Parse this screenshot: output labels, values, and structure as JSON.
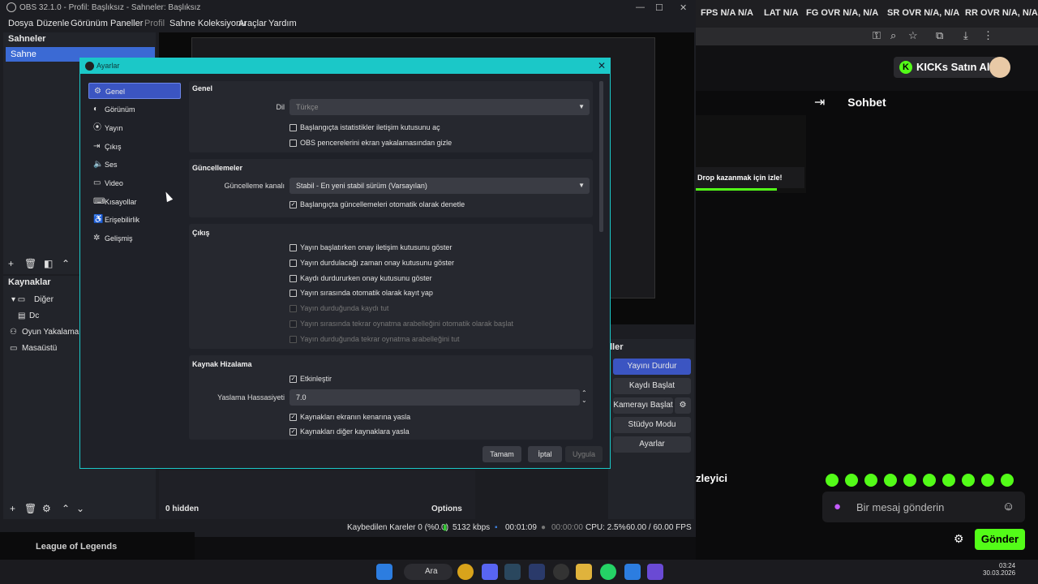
{
  "browser": {
    "tabs": [
      "FPS N/A N/A",
      "LAT N/A",
      "FG OVR N/A, N/A",
      "SR OVR N/A, N/A",
      "RR OVR N/A, N/A"
    ],
    "buy_button": "KICKs Satın Al",
    "chat_title": "Sohbet",
    "drop_banner": "Drop kazanmak için izle!",
    "viewer_label": "zleyici",
    "chat_placeholder": "Bir mesaj gönderin",
    "send_label": "Gönder"
  },
  "obs": {
    "title": "OBS 32.1.0 - Profil: Başlıksız - Sahneler: Başlıksız",
    "menu": [
      "Dosya",
      "Düzenle",
      "Görünüm",
      "Paneller",
      "Profil",
      "Sahne Koleksiyonu",
      "Araçlar",
      "Yardım"
    ],
    "scenes_title": "Sahneler",
    "scene_name": "Sahne",
    "sources_title": "Kaynaklar",
    "sources": [
      "Diğer",
      "Dc",
      "Oyun Yakalama",
      "Masaüstü"
    ],
    "hidden_label": "0 hidden",
    "options_label": "Options",
    "controls": {
      "title": "ller",
      "buttons": [
        "Yayını Durdur",
        "Kaydı Başlat",
        "Kamerayı Başlat",
        "Stüdyo Modu",
        "Ayarlar"
      ]
    },
    "status": {
      "dropped": "Kaybedilen Kareler 0 (%0.0)",
      "bitrate": "5132 kbps",
      "stream_time": "00:01:09",
      "rec_time": "00:00:00",
      "cpu": "CPU: 2.5%",
      "fps": "60.00 / 60.00 FPS"
    }
  },
  "game": {
    "name": "League of Legends"
  },
  "taskbar": {
    "search_label": "Ara",
    "time": "03:24",
    "date": "30.03.2026"
  },
  "settings": {
    "title": "Ayarlar",
    "nav": [
      "Genel",
      "Görünüm",
      "Yayın",
      "Çıkış",
      "Ses",
      "Video",
      "Kısayollar",
      "Erişebilirlik",
      "Gelişmiş"
    ],
    "nav_icons": [
      "⚙",
      "◐",
      "⦿",
      "⇥",
      "🔈",
      "▭",
      "⌨",
      "♿",
      "✲"
    ],
    "general": {
      "title": "Genel",
      "language_label": "Dil",
      "language_value": "Türkçe",
      "checks": [
        "Başlangıçta istatistikler iletişim kutusunu aç",
        "OBS pencerelerini ekran yakalamasından gizle"
      ]
    },
    "updates": {
      "title": "Güncellemeler",
      "channel_label": "Güncelleme kanalı",
      "channel_value": "Stabil - En yeni stabil sürüm (Varsayılan)",
      "check": "Başlangıçta güncellemeleri otomatik olarak denetle"
    },
    "output": {
      "title": "Çıkış",
      "checks": [
        "Yayın başlatırken onay iletişim kutusunu göster",
        "Yayın durdulacağı zaman onay kutusunu göster",
        "Kaydı durdururken onay kutusunu göster",
        "Yayın sırasında otomatik olarak kayıt yap",
        "Yayın durduğunda kaydı tut",
        "Yayın sırasında tekrar oynatma arabelleğini otomatik olarak başlat",
        "Yayın durduğunda tekrar oynatma arabelleğini tut"
      ]
    },
    "snap": {
      "title": "Kaynak Hizalama",
      "enable": "Etkinleştir",
      "sensitivity_label": "Yaslama Hassasiyeti",
      "sensitivity_value": "7.0",
      "checks": [
        "Kaynakları ekranın kenarına yasla",
        "Kaynakları diğer kaynaklara yasla"
      ]
    },
    "buttons": {
      "ok": "Tamam",
      "cancel": "İptal",
      "apply": "Uygula"
    }
  }
}
